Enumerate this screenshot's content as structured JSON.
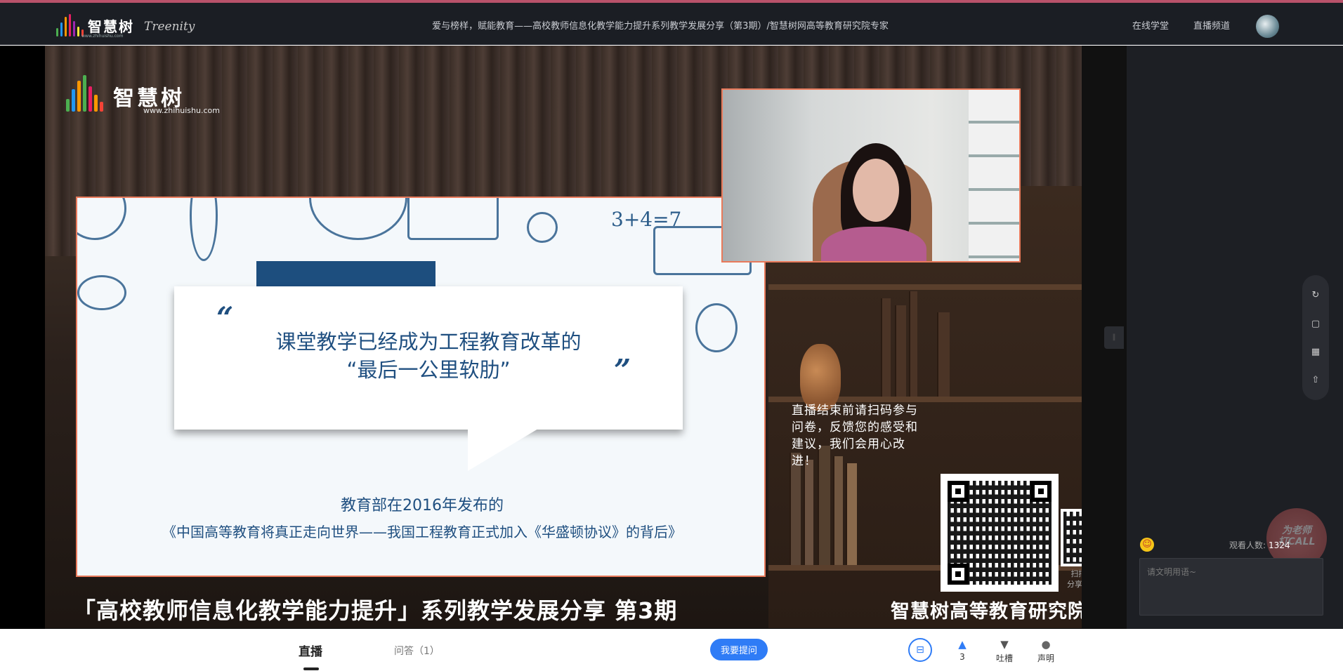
{
  "header": {
    "logo_cn": "智慧树",
    "logo_url": "www.zhihuishu.com",
    "logo_en": "Treenity",
    "title": "爱与榜样，赋能教育——高校教师信息化教学能力提升系列教学发展分享（第3期）/智慧树网高等教育研究院专家",
    "nav": [
      "在线学堂",
      "直播频道"
    ]
  },
  "video": {
    "logo_cn": "智慧树",
    "logo_url": "www.zhihuishu.com",
    "slide": {
      "doodle_math": "3+4=7",
      "quote_open": "“",
      "quote_close": "”",
      "bubble_line1": "课堂教学已经成为工程教育改革的",
      "bubble_line2": "“最后一公里软肋”",
      "sub1": "教育部在2016年发布的",
      "sub2": "《中国高等教育将真正走向世界——我国工程教育正式加入《华盛顿协议》的背后》"
    },
    "qr_text": "直播结束前请扫码参与问卷，反馈您的感受和建议，我们会用心改进！",
    "qr_small_caption": [
      "扫描二维码",
      "分享给好友吧"
    ],
    "bottom_title": "「高校教师信息化教学能力提升」系列教学发展分享 第3期",
    "bottom_org": "智慧树高等教育研究院"
  },
  "side": {
    "call_badge": [
      "为老师",
      "打CALL"
    ],
    "viewer_label": "观看人数:",
    "viewer_count": "1324",
    "chat_placeholder": "请文明用语~"
  },
  "bottom": {
    "tab_live": "直播",
    "tab_qa": "问答（1）",
    "ask_button": "我要提问",
    "actions": [
      {
        "label": "3",
        "icon": "thumbs-up-icon"
      },
      {
        "label": "吐槽",
        "icon": "thumbs-down-icon"
      },
      {
        "label": "声明",
        "icon": "info-icon"
      }
    ]
  },
  "colors": {
    "accent_blue": "#2f7cf6",
    "header_bg": "#1b1e24",
    "slide_blue": "#1f4f80",
    "slide_border": "#e97a5b"
  }
}
